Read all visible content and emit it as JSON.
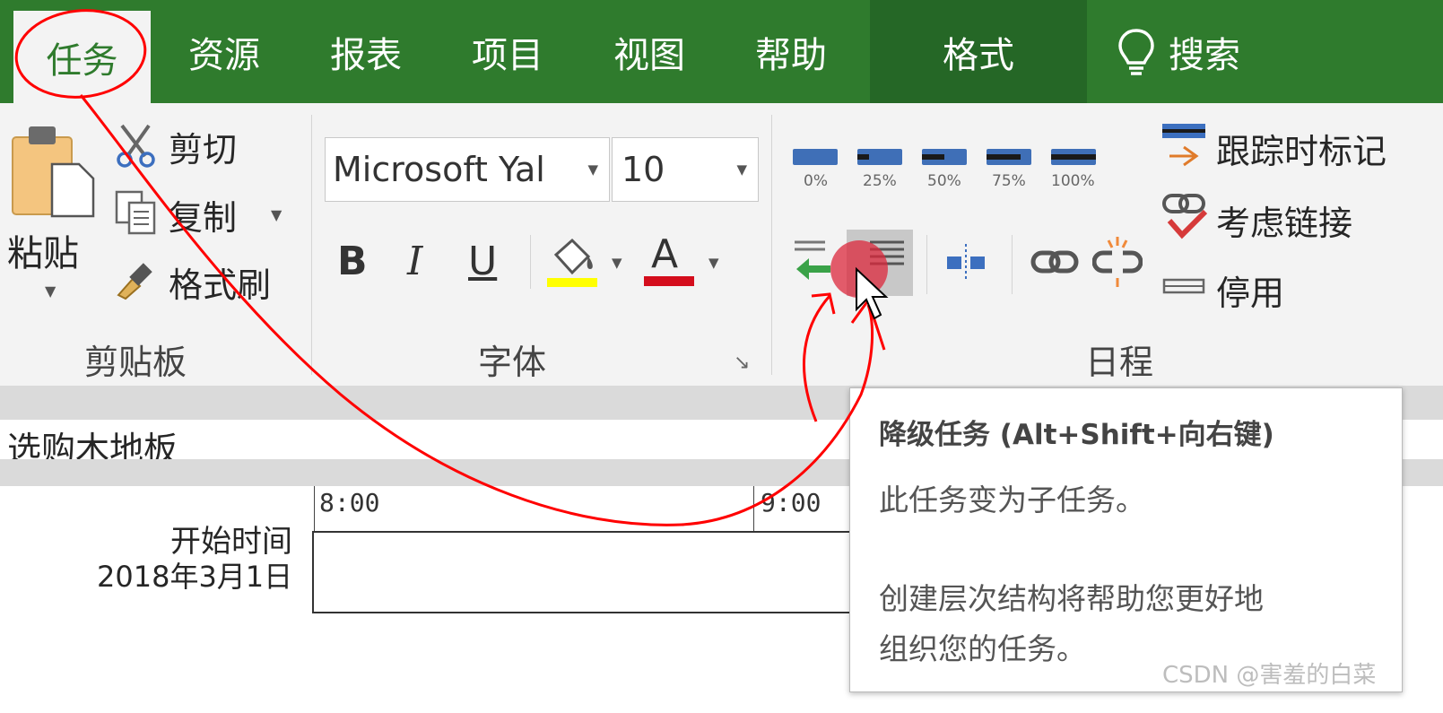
{
  "tabs": [
    {
      "label": "任务",
      "active": true
    },
    {
      "label": "资源"
    },
    {
      "label": "报表"
    },
    {
      "label": "项目"
    },
    {
      "label": "视图"
    },
    {
      "label": "帮助"
    },
    {
      "label": "格式",
      "contextual": true
    }
  ],
  "search": {
    "icon": "lightbulb-icon",
    "label": "搜索"
  },
  "clipboard": {
    "paste_label": "粘贴",
    "cut_label": "剪切",
    "copy_label": "复制",
    "format_painter_label": "格式刷",
    "group_label": "剪贴板"
  },
  "font": {
    "family": "Microsoft Yal",
    "size": "10",
    "bold": "B",
    "italic": "I",
    "underline": "U",
    "color_glyph": "A",
    "group_label": "字体",
    "highlight_color": "#ffff00",
    "font_color": "#d40d1c"
  },
  "schedule": {
    "percent_labels": [
      "0%",
      "25%",
      "50%",
      "75%",
      "100%"
    ],
    "percent_values": [
      0,
      25,
      50,
      75,
      100
    ],
    "mark_on_track_label": "跟踪时标记",
    "respect_links_label": "考虑链接",
    "inactivate_label": "停用",
    "group_label": "日程"
  },
  "task_name": "选购木地板",
  "timeline": {
    "start_label": "开始时间",
    "start_date": "2018年3月1日",
    "ticks": [
      "8:00",
      "9:00"
    ]
  },
  "tooltip": {
    "title": "降级任务 (Alt+Shift+向右键)",
    "line1": "此任务变为子任务。",
    "line2": "创建层次结构将帮助您更好地",
    "line3": "组织您的任务。"
  },
  "watermark": "CSDN @害羞的白菜",
  "colors": {
    "ribbon_green": "#2f7b2d",
    "annotation_red": "#ff0000"
  }
}
